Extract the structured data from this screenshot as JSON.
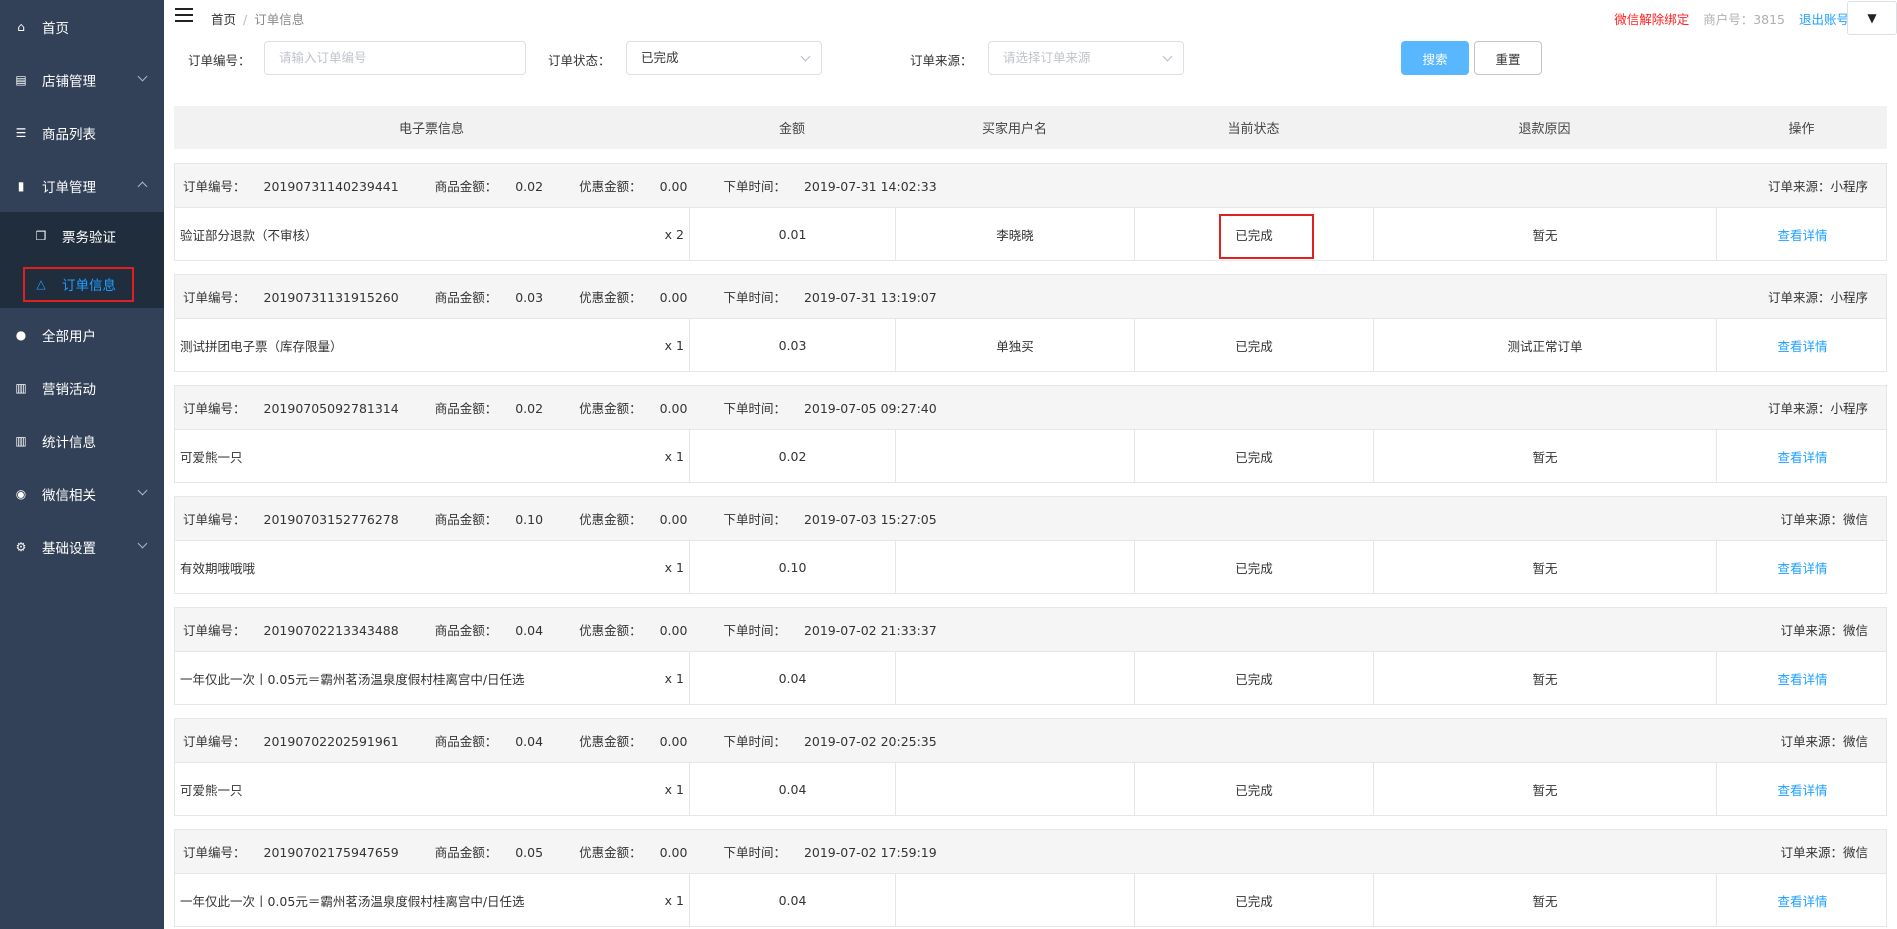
{
  "sidebar": {
    "items": [
      {
        "label": "首页",
        "icon": "home-icon",
        "glyph": "⌂"
      },
      {
        "label": "店铺管理",
        "icon": "shop-icon",
        "glyph": "▤"
      },
      {
        "label": "商品列表",
        "icon": "list-icon",
        "glyph": "☰"
      },
      {
        "label": "订单管理",
        "icon": "document-icon",
        "glyph": "▮"
      },
      {
        "label": "票务验证",
        "icon": "cube-icon",
        "glyph": "❒"
      },
      {
        "label": "订单信息",
        "icon": "triangle-icon",
        "glyph": "△"
      },
      {
        "label": "全部用户",
        "icon": "users-icon",
        "glyph": "👥"
      },
      {
        "label": "营销活动",
        "icon": "bar-chart-icon",
        "glyph": "▥"
      },
      {
        "label": "统计信息",
        "icon": "stats-icon",
        "glyph": "▥"
      },
      {
        "label": "微信相关",
        "icon": "wechat-icon",
        "glyph": "💬"
      },
      {
        "label": "基础设置",
        "icon": "gear-icon",
        "glyph": "⚙"
      }
    ]
  },
  "header": {
    "breadcrumb_home": "首页",
    "breadcrumb_sep": "/",
    "breadcrumb_current": "订单信息",
    "unbind_wechat": "微信解除绑定",
    "merchant_id": "商户号：3815",
    "logout": "退出账号",
    "dropdown_glyph": "▼"
  },
  "filters": {
    "order_no_label": "订单编号：",
    "order_no_placeholder": "请输入订单编号",
    "status_label": "订单状态：",
    "status_value": "已完成",
    "source_label": "订单来源：",
    "source_placeholder": "请选择订单来源",
    "search_button": "搜索",
    "reset_button": "重置"
  },
  "table": {
    "columns": [
      "电子票信息",
      "金额",
      "买家用户名",
      "当前状态",
      "退款原因",
      "操作"
    ],
    "order_no_prefix": "订单编号：",
    "goods_amount_prefix": "商品金额：",
    "discount_prefix": "优惠金额：",
    "time_prefix": "下单时间：",
    "source_prefix": "订单来源：",
    "detail_link": "查看详情",
    "orders": [
      {
        "order_no": "20190731140239441",
        "goods_amount": "0.02",
        "discount": "0.00",
        "time": "2019-07-31 14:02:33",
        "source": "小程序",
        "item": "验证部分退款（不审核）",
        "qty": "x 2",
        "amount": "0.01",
        "buyer": "李晓晓",
        "status": "已完成",
        "refund": "暂无"
      },
      {
        "order_no": "20190731131915260",
        "goods_amount": "0.03",
        "discount": "0.00",
        "time": "2019-07-31 13:19:07",
        "source": "小程序",
        "item": "测试拼团电子票（库存限量）",
        "qty": "x 1",
        "amount": "0.03",
        "buyer": "单独买",
        "status": "已完成",
        "refund": "测试正常订单"
      },
      {
        "order_no": "20190705092781314",
        "goods_amount": "0.02",
        "discount": "0.00",
        "time": "2019-07-05 09:27:40",
        "source": "小程序",
        "item": "可爱熊一只",
        "qty": "x 1",
        "amount": "0.02",
        "buyer": "",
        "status": "已完成",
        "refund": "暂无"
      },
      {
        "order_no": "20190703152776278",
        "goods_amount": "0.10",
        "discount": "0.00",
        "time": "2019-07-03 15:27:05",
        "source": "微信",
        "item": "有效期哦哦哦",
        "qty": "x 1",
        "amount": "0.10",
        "buyer": "",
        "status": "已完成",
        "refund": "暂无"
      },
      {
        "order_no": "20190702213343488",
        "goods_amount": "0.04",
        "discount": "0.00",
        "time": "2019-07-02 21:33:37",
        "source": "微信",
        "item": "一年仅此一次丨0.05元＝霸州茗汤温泉度假村桂离宫中/日任选",
        "qty": "x 1",
        "amount": "0.04",
        "buyer": "",
        "status": "已完成",
        "refund": "暂无"
      },
      {
        "order_no": "20190702202591961",
        "goods_amount": "0.04",
        "discount": "0.00",
        "time": "2019-07-02 20:25:35",
        "source": "微信",
        "item": "可爱熊一只",
        "qty": "x 1",
        "amount": "0.04",
        "buyer": "",
        "status": "已完成",
        "refund": "暂无"
      },
      {
        "order_no": "20190702175947659",
        "goods_amount": "0.05",
        "discount": "0.00",
        "time": "2019-07-02 17:59:19",
        "source": "微信",
        "item": "一年仅此一次丨0.05元＝霸州茗汤温泉度假村桂离宫中/日任选",
        "qty": "x 1",
        "amount": "0.04",
        "buyer": "",
        "status": "已完成",
        "refund": "暂无"
      }
    ]
  },
  "colors": {
    "sidebar_bg": "#324157",
    "submenu_bg": "#1f2d3d",
    "accent": "#20a0ff",
    "primary_button": "#58b7ff",
    "highlight_box": "#e02020"
  }
}
